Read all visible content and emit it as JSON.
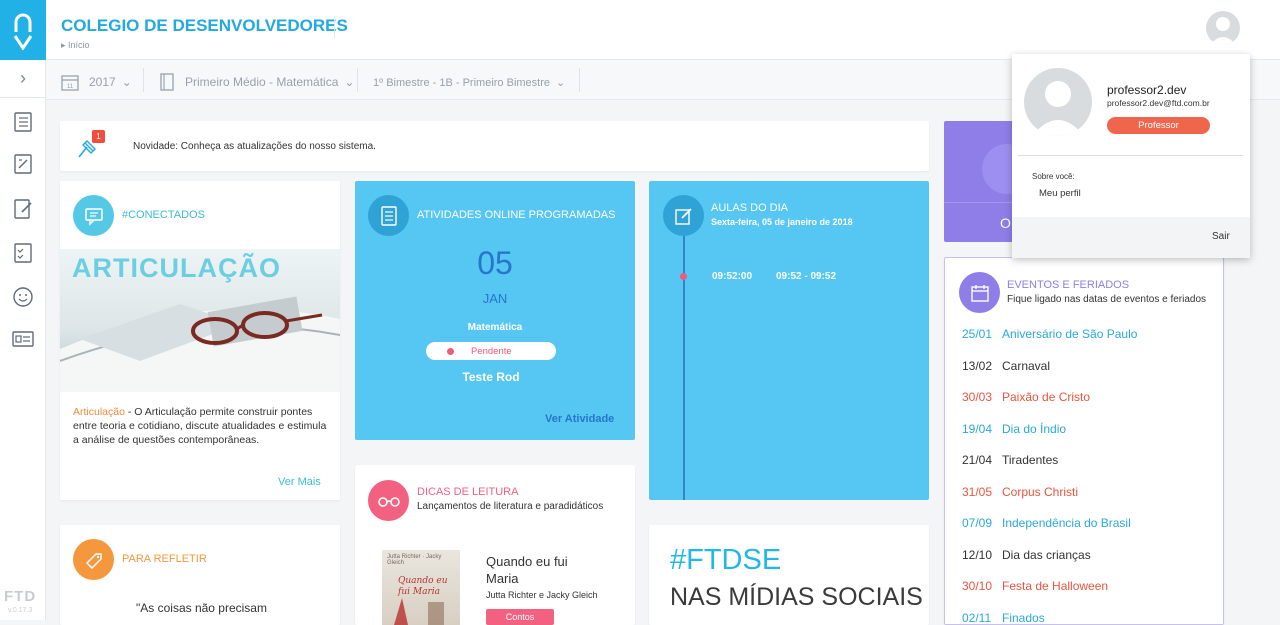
{
  "header": {
    "school_name": "COLEGIO DE DESENVOLVEDORES",
    "breadcrumb": "Início"
  },
  "filters": {
    "year": "2017",
    "calendar_day": "11",
    "course": "Primeiro Médio - Matemática",
    "period": "1º Bimestre - 1B - Primeiro Bimestre"
  },
  "sidebar": {
    "footer_logo": "FTD",
    "version": "v.0.17.3"
  },
  "notice": {
    "badge": "1",
    "text": "Novidade: Conheça as atualizações do nosso sistema."
  },
  "conectados": {
    "title": "#CONECTADOS",
    "image_text": "ARTICULAÇÃO",
    "link_word": "Articulação",
    "description": " - O Articulação permite construir pontes entre teoria e cotidiano, discute atualidades e estimula a análise de questões contemporâneas.",
    "more": "Ver Mais"
  },
  "refletir": {
    "title": "PARA REFLETIR",
    "quote": "\"As coisas não precisam"
  },
  "atividades": {
    "title": "ATIVIDADES ONLINE PROGRAMADAS",
    "day": "05",
    "month": "JAN",
    "subject": "Matemática",
    "status": "Pendente",
    "name": "Teste Rod",
    "link": "Ver Atividade"
  },
  "aulas": {
    "title": "AULAS DO DIA",
    "date": "Sexta-feira, 05 de janeiro de 2018",
    "time": "09:52:00",
    "range": "09:52 - 09:52"
  },
  "leitura": {
    "title": "DICAS DE LEITURA",
    "subtitle": "Lançamentos de literatura e paradidáticos",
    "book_title": "Quando eu fui Maria",
    "authors": "Jutta Richter e Jacky Gleich",
    "tag": "Contos",
    "cover_title": "Quando eu fui Maria",
    "cover_authors": "Jutta Richter · Jacky Gleich"
  },
  "ftdse": {
    "hashtag": "#FTDSE",
    "text": "NAS MÍDIAS SOCIAIS"
  },
  "purple_card": {
    "text": "O"
  },
  "eventos": {
    "title": "EVENTOS E FERIADOS",
    "subtitle": "Fique ligado nas datas de eventos e feriados",
    "items": [
      {
        "date": "25/01",
        "name": "Aniversário de São Paulo",
        "color": "#2aa8dc"
      },
      {
        "date": "13/02",
        "name": "Carnaval",
        "color": "#333333"
      },
      {
        "date": "30/03",
        "name": "Paixão de Cristo",
        "color": "#e8553e"
      },
      {
        "date": "19/04",
        "name": "Dia do Índio",
        "color": "#2aa8dc"
      },
      {
        "date": "21/04",
        "name": "Tiradentes",
        "color": "#333333"
      },
      {
        "date": "31/05",
        "name": "Corpus Christi",
        "color": "#e8553e"
      },
      {
        "date": "07/09",
        "name": "Independência do Brasil",
        "color": "#2aa8dc"
      },
      {
        "date": "12/10",
        "name": "Dia das crianças",
        "color": "#333333"
      },
      {
        "date": "30/10",
        "name": "Festa de Halloween",
        "color": "#e8553e"
      },
      {
        "date": "02/11",
        "name": "Finados",
        "color": "#2aa8dc"
      }
    ]
  },
  "profile": {
    "username": "professor2.dev",
    "email": "professor2.dev@ftd.com.br",
    "role": "Professor",
    "about": "Sobre você:",
    "my_profile": "Meu perfil",
    "logout": "Sair"
  },
  "colors": {
    "brand_blue": "#22b1e6",
    "card_blue": "#56c6f2",
    "orange": "#f5983d",
    "pink": "#f2617f",
    "purple": "#8f7ee8",
    "role_badge": "#f0664d"
  }
}
